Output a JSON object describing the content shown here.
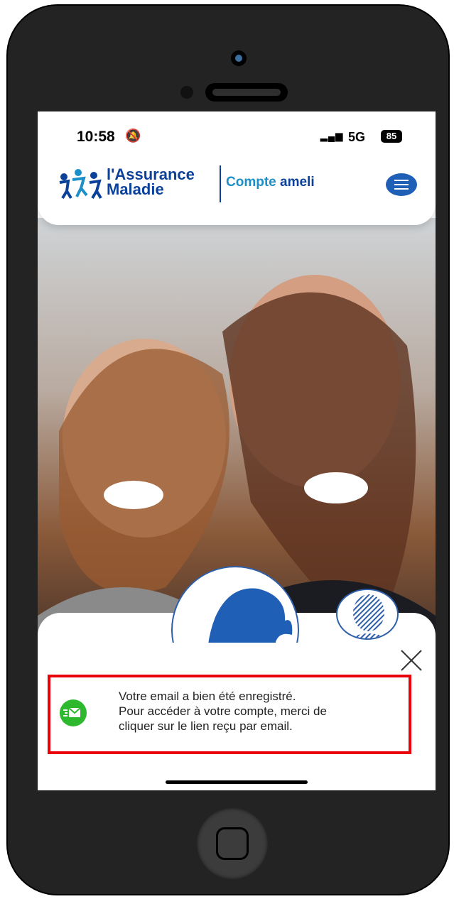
{
  "status_bar": {
    "time": "10:58",
    "bell_icon": "bell-slash-icon",
    "network": "5G",
    "battery": "85"
  },
  "header": {
    "brand_line1": "l'Assurance",
    "brand_line2": "Maladie",
    "compte_label": "Compte",
    "ameli_label": "ameli",
    "menu_icon": "menu-icon"
  },
  "notification": {
    "line1": "Votre email a bien été enregistré.",
    "line2": "Pour accéder à votre compte, merci de",
    "line3": "cliquer sur le lien reçu par email.",
    "icon": "email-sent-icon",
    "close_icon": "close-icon"
  },
  "colors": {
    "brand_blue": "#0c419a",
    "accent_cyan": "#1b8fc7",
    "toast_border": "#e8000b",
    "success_green": "#2eb82e"
  }
}
